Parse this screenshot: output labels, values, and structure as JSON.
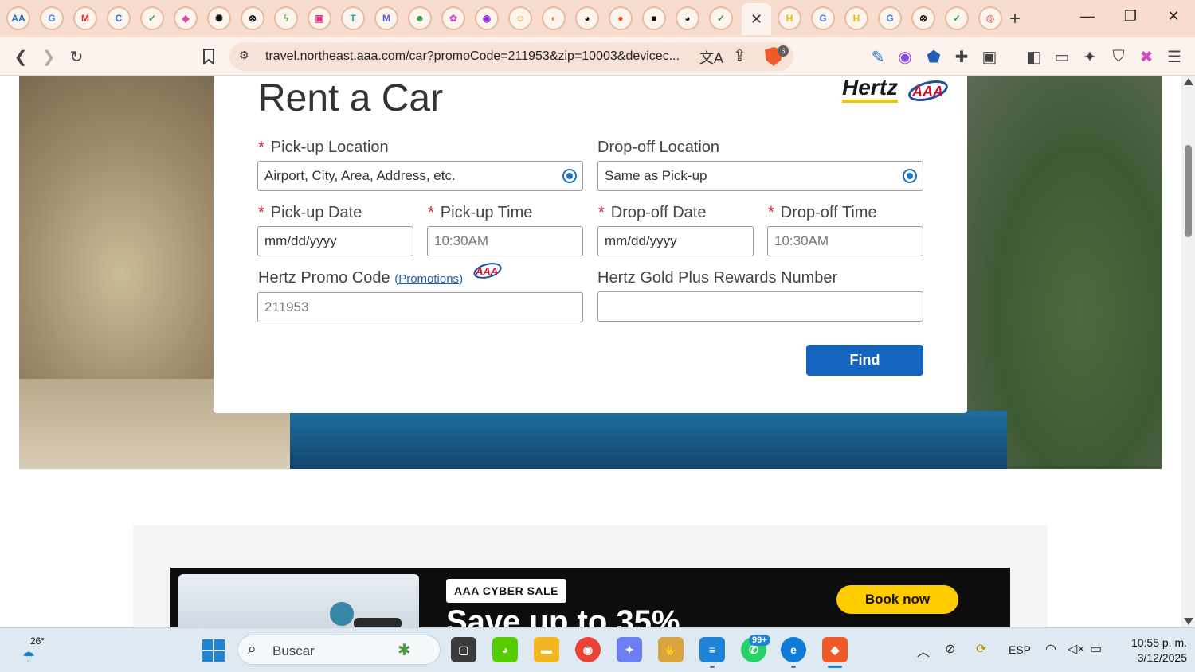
{
  "browser": {
    "active_tab_close": "✕",
    "new_tab": "+",
    "window_controls": {
      "minimize": "—",
      "restore": "❐",
      "close": "✕"
    },
    "url": "travel.northeast.aaa.com/car?promoCode=211953&zip=10003&devicec...",
    "brave_shield_count": "6",
    "toolbar_icons": [
      "back-icon",
      "forward-icon",
      "reload-icon",
      "bookmark-icon",
      "site-settings-icon",
      "translate-icon",
      "share-icon",
      "brave-shield-icon",
      "edit-icon",
      "leo-icon",
      "vpn-icon",
      "extensions-icon",
      "screenshot-icon",
      "sidebar-icon",
      "wallet-icon",
      "ai-icon",
      "shield-icon",
      "rewards-icon",
      "menu-icon"
    ]
  },
  "tabs": [
    {
      "icon": "aaa-icon",
      "glyph": "AA",
      "color": "#1f6fc4"
    },
    {
      "icon": "google-icon",
      "glyph": "G",
      "color": "#4285f4"
    },
    {
      "icon": "gmail-icon",
      "glyph": "M",
      "color": "#d93025"
    },
    {
      "icon": "copilot-c-icon",
      "glyph": "C",
      "color": "#1a73e8"
    },
    {
      "icon": "chatgpt-green-icon",
      "glyph": "✓",
      "color": "#2ea043"
    },
    {
      "icon": "canva-icon",
      "glyph": "◆",
      "color": "#d84ba3"
    },
    {
      "icon": "openai-icon",
      "glyph": "✺",
      "color": "#111"
    },
    {
      "icon": "x-circle-icon",
      "glyph": "⊗",
      "color": "#111"
    },
    {
      "icon": "perplexity-icon",
      "glyph": "ϟ",
      "color": "#6aa84f"
    },
    {
      "icon": "chat-icon",
      "glyph": "▣",
      "color": "#d63384"
    },
    {
      "icon": "translate-t-icon",
      "glyph": "T",
      "color": "#1aa3b8"
    },
    {
      "icon": "mail-m-icon",
      "glyph": "M",
      "color": "#5b5fd6"
    },
    {
      "icon": "smile-icon",
      "glyph": "☻",
      "color": "#2b9a3e"
    },
    {
      "icon": "flower-icon",
      "glyph": "✿",
      "color": "#c54fc0"
    },
    {
      "icon": "gradient-icon",
      "glyph": "◉",
      "color": "#8a2be2"
    },
    {
      "icon": "emoji-icon",
      "glyph": "☺",
      "color": "#e0a100"
    },
    {
      "icon": "orange-circle-icon",
      "glyph": "◐",
      "color": "#f08a24"
    },
    {
      "icon": "github-icon",
      "glyph": "◕",
      "color": "#111"
    },
    {
      "icon": "reddit-icon",
      "glyph": "●",
      "color": "#ff4500"
    },
    {
      "icon": "notion-icon",
      "glyph": "■",
      "color": "#111"
    },
    {
      "icon": "github-black-icon",
      "glyph": "◕",
      "color": "#111"
    },
    {
      "icon": "chatgpt-icon",
      "glyph": "✓",
      "color": "#2ea043"
    }
  ],
  "tabs_after": [
    {
      "icon": "hertz-h-icon",
      "glyph": "H",
      "color": "#e6b400"
    },
    {
      "icon": "google-g-icon",
      "glyph": "G",
      "color": "#4285f4"
    },
    {
      "icon": "hertz-h2-icon",
      "glyph": "H",
      "color": "#e6b400"
    },
    {
      "icon": "google-g2-icon",
      "glyph": "G",
      "color": "#4285f4"
    },
    {
      "icon": "x-circle2-icon",
      "glyph": "⊗",
      "color": "#111"
    },
    {
      "icon": "chatgpt2-icon",
      "glyph": "✓",
      "color": "#2ea043"
    },
    {
      "icon": "target-icon",
      "glyph": "◎",
      "color": "#e57373"
    }
  ],
  "form": {
    "title": "Rent a Car",
    "brand_hertz": "Hertz",
    "pickup_location_label": "Pick-up Location",
    "pickup_location_placeholder": "Airport, City, Area, Address, etc.",
    "dropoff_location_label": "Drop-off Location",
    "dropoff_location_placeholder": "Same as Pick-up",
    "pickup_date_label": "Pick-up Date",
    "pickup_date_placeholder": "mm/dd/yyyy",
    "pickup_time_label": "Pick-up Time",
    "pickup_time_value": "10:30AM",
    "dropoff_date_label": "Drop-off Date",
    "dropoff_date_placeholder": "mm/dd/yyyy",
    "dropoff_time_label": "Drop-off Time",
    "dropoff_time_value": "10:30AM",
    "promo_label": "Hertz Promo Code",
    "promo_link": "Promotions",
    "promo_open": "(",
    "promo_close": ")",
    "promo_value": "211953",
    "gold_plus_label": "Hertz Gold Plus Rewards Number",
    "gold_plus_value": "",
    "required_mark": "*",
    "find_button": "Find"
  },
  "promo_banner": {
    "badge": "AAA CYBER SALE",
    "headline": "Save up to 35%",
    "cta": "Book now"
  },
  "taskbar": {
    "temperature": "26°",
    "search_placeholder": "Buscar",
    "whatsapp_badge": "99+",
    "language": "ESP",
    "time": "10:55 p. m.",
    "date": "3/12/2025"
  }
}
